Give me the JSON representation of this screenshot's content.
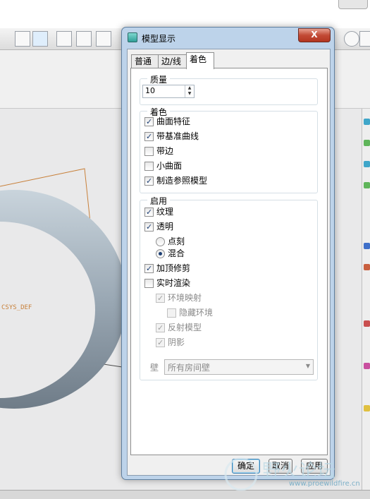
{
  "dialog": {
    "title": "模型显示",
    "close_glyph": "X",
    "tabs": [
      {
        "label": "普通",
        "active": false
      },
      {
        "label": "边/线",
        "active": false
      },
      {
        "label": "着色",
        "active": true
      }
    ],
    "quality": {
      "legend": "质量",
      "value": "10"
    },
    "shading": {
      "legend": "着色",
      "items": [
        {
          "label": "曲面特征",
          "checked": true
        },
        {
          "label": "带基准曲线",
          "checked": true
        },
        {
          "label": "带边",
          "checked": false
        },
        {
          "label": "小曲面",
          "checked": false
        },
        {
          "label": "制造参照模型",
          "checked": true
        }
      ]
    },
    "enable": {
      "legend": "启用",
      "texture": {
        "label": "纹理",
        "checked": true
      },
      "transparency": {
        "label": "透明",
        "checked": true
      },
      "transparency_modes": [
        {
          "label": "点刻",
          "selected": false
        },
        {
          "label": "混合",
          "selected": true
        }
      ],
      "cap_clipping": {
        "label": "加顶修剪",
        "checked": true
      },
      "realtime_render": {
        "label": "实时渲染",
        "checked": false
      },
      "env_mapping": {
        "label": "环境映射",
        "checked": true,
        "enabled": false
      },
      "hide_env": {
        "label": "隐藏环境",
        "checked": false,
        "enabled": false
      },
      "reflect_model": {
        "label": "反射模型",
        "checked": true,
        "enabled": false
      },
      "shadow": {
        "label": "阴影",
        "checked": true,
        "enabled": false
      },
      "wall_label": "壁",
      "wall_value": "所有房间壁"
    },
    "buttons": {
      "ok": "确定",
      "cancel": "取消",
      "apply": "应用"
    }
  },
  "viewport": {
    "csys_label": "CSYS_DEF"
  },
  "watermark": {
    "url": "www.proewildfire.cn"
  },
  "colors": {
    "dialog_frame": "#bdd3ea",
    "close_button": "#c24a35",
    "check_mark": "#1d3f74",
    "torus": "#a8b4bf",
    "datum_orange": "#c8803a"
  }
}
